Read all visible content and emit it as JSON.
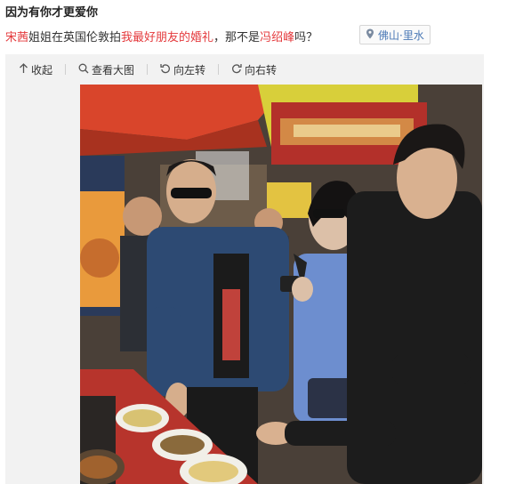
{
  "post": {
    "title": "因为有你才更爱你",
    "caption": {
      "name1": "宋茜",
      "text1": "姐姐在英国伦敦拍",
      "link": "我最好朋友的婚礼",
      "text2": "，那不是",
      "name2": "冯绍峰",
      "text3": "吗？"
    },
    "location": {
      "icon": "location-pin-icon",
      "label": "佛山·里水"
    }
  },
  "toolbar": {
    "collapse_label": "收起",
    "view_large_label": "查看大图",
    "rotate_left_label": "向左转",
    "rotate_right_label": "向右转"
  },
  "colors": {
    "highlight": "#e4393c",
    "location_text": "#4a78b5",
    "panel_bg": "#f2f2f2"
  }
}
